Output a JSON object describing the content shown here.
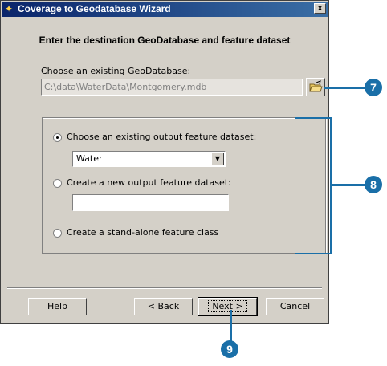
{
  "window": {
    "title": "Coverage to Geodatabase Wizard",
    "close_glyph": "x"
  },
  "heading": "Enter the destination GeoDatabase and feature dataset",
  "geodatabase": {
    "label": "Choose an existing GeoDatabase:",
    "path": "C:\\data\\WaterData\\Montgomery.mdb"
  },
  "options": {
    "existing_dataset_label": "Choose an existing output feature dataset:",
    "existing_dataset_value": "Water",
    "new_dataset_label": "Create a new output feature dataset:",
    "new_dataset_value": "",
    "standalone_label": "Create a stand-alone feature class"
  },
  "buttons": {
    "help": "Help",
    "back": "< Back",
    "next": "Next >",
    "cancel": "Cancel"
  },
  "callouts": {
    "step7": "7",
    "step8": "8",
    "step9": "9"
  },
  "colors": {
    "callout": "#1a6fa8",
    "titlebar": "#0a246a",
    "dialog": "#d4d0c8"
  }
}
